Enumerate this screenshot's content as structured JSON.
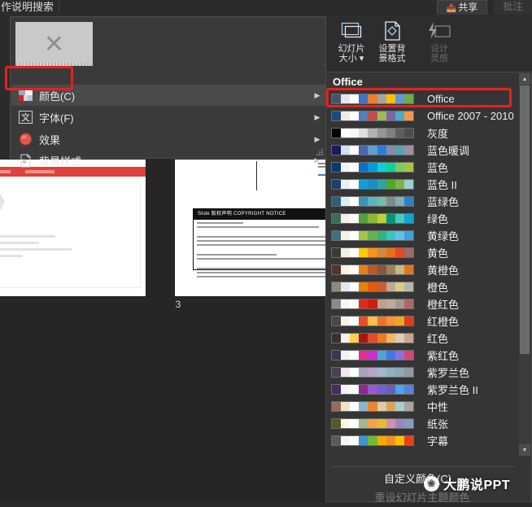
{
  "topbar": {
    "tell_me_text": "作说明搜索",
    "share_label": "共享",
    "share_icon": "share-icon",
    "far_button_label": "批注"
  },
  "ribbon": {
    "buttons": [
      {
        "id": "slide-size",
        "label": "幻灯片\n大小 ▾",
        "icon": "slide-size-icon",
        "disabled": false
      },
      {
        "id": "format-background",
        "label": "设置背\n景格式",
        "icon": "format-background-icon",
        "disabled": false
      },
      {
        "id": "design-ideas",
        "label": "设计\n灵感",
        "icon": "design-ideas-icon",
        "disabled": true
      }
    ]
  },
  "variants_menu": {
    "preview_icon": "x-placeholder-icon",
    "items": [
      {
        "id": "color",
        "label": "颜色(C)",
        "icon": "color-palette-icon",
        "selected": true,
        "has_submenu": true
      },
      {
        "id": "font",
        "label": "字体(F)",
        "icon": "font-icon",
        "selected": false,
        "has_submenu": true
      },
      {
        "id": "effect",
        "label": "效果",
        "icon": "effect-circle-icon",
        "selected": false,
        "has_submenu": true
      },
      {
        "id": "bgstyle",
        "label": "背景样式",
        "icon": "background-style-icon",
        "selected": false,
        "has_submenu": true
      }
    ],
    "arrow_glyph": "▶"
  },
  "annotations": {
    "highlight_color": "#e8201f",
    "boxes": [
      "color-menu-item",
      "office-theme-row"
    ]
  },
  "stage": {
    "slide_number": "3",
    "slide_left": {
      "title_bar_color": "#e0413a"
    },
    "slide_mid": {
      "notice_header": "Slide 版权声明 COPYRIGHT NOTICE"
    }
  },
  "flyout": {
    "title": "Office",
    "custom_colors_label": "自定义颜色(C)...",
    "reset_colors_label": "重设幻灯片主题颜色",
    "reset_disabled": true,
    "scroll_up_glyph": "▲",
    "scroll_down_glyph": "▼",
    "themes": [
      {
        "name": "Office",
        "selected": true,
        "colors": [
          "#44546a",
          "#e7e6e6",
          "#ffffff",
          "#4472c4",
          "#ed7d31",
          "#a5a5a5",
          "#ffc000",
          "#5b9bd5",
          "#70ad47"
        ]
      },
      {
        "name": "Office 2007 - 2010",
        "selected": false,
        "colors": [
          "#1f497d",
          "#eeece1",
          "#ffffff",
          "#4f81bd",
          "#c0504d",
          "#9bbb59",
          "#8064a2",
          "#4bacc6",
          "#f79646"
        ]
      },
      {
        "name": "灰度",
        "selected": false,
        "colors": [
          "#000000",
          "#ffffff",
          "#f8f8f8",
          "#dddddd",
          "#b2b2b2",
          "#969696",
          "#808080",
          "#5f5f5f",
          "#4d4d4d"
        ]
      },
      {
        "name": "蓝色暖调",
        "selected": false,
        "colors": [
          "#1a1a5e",
          "#cfe2f3",
          "#ffffff",
          "#4a66ac",
          "#629dd1",
          "#297fd5",
          "#7f8fa9",
          "#5aa2ae",
          "#9d90a0"
        ]
      },
      {
        "name": "蓝色",
        "selected": false,
        "colors": [
          "#073a6f",
          "#f2f2f2",
          "#ffffff",
          "#0f6fc6",
          "#009dd9",
          "#0bd0d9",
          "#10cf9b",
          "#7cca62",
          "#a5c249"
        ]
      },
      {
        "name": "蓝色 II",
        "selected": false,
        "colors": [
          "#1c3f6e",
          "#e9eef2",
          "#ffffff",
          "#0f9ed5",
          "#1790c3",
          "#2fa4a4",
          "#4ea72e",
          "#7fb24b",
          "#a0cfd0"
        ]
      },
      {
        "name": "蓝绿色",
        "selected": false,
        "colors": [
          "#335e78",
          "#ddeff5",
          "#ffffff",
          "#3494ba",
          "#58b6c0",
          "#75bda7",
          "#7a8c8e",
          "#84acb6",
          "#2683c6"
        ]
      },
      {
        "name": "绿色",
        "selected": false,
        "colors": [
          "#3c6b5b",
          "#f2f2e6",
          "#ffffff",
          "#549e39",
          "#8ab833",
          "#c0cf3a",
          "#029676",
          "#4ec6c0",
          "#13a4d4"
        ]
      },
      {
        "name": "黄绿色",
        "selected": false,
        "colors": [
          "#43707a",
          "#f4f4e6",
          "#ffffff",
          "#a2c441",
          "#62b44a",
          "#2fb67c",
          "#35c6c4",
          "#5cc2e8",
          "#3f9fe0"
        ]
      },
      {
        "name": "黄色",
        "selected": false,
        "colors": [
          "#3b3b33",
          "#f3f0e2",
          "#ffffff",
          "#ffca08",
          "#f8931d",
          "#ce8d3e",
          "#ec7016",
          "#e64823",
          "#9c6a6a"
        ]
      },
      {
        "name": "黄橙色",
        "selected": false,
        "colors": [
          "#51342a",
          "#fdf2e4",
          "#ffffff",
          "#e48312",
          "#bd582c",
          "#865640",
          "#9b8357",
          "#c2bc80",
          "#e0751c"
        ]
      },
      {
        "name": "橙色",
        "selected": false,
        "colors": [
          "#8c8c78",
          "#dfeaf1",
          "#ffffff",
          "#e48312",
          "#e8590c",
          "#cf5b34",
          "#c0a98d",
          "#d4cc8d",
          "#b6b6a6"
        ]
      },
      {
        "name": "橙红色",
        "selected": false,
        "colors": [
          "#8b8b8b",
          "#f6f6f6",
          "#ffffff",
          "#e02a1d",
          "#cf1c13",
          "#c0a08d",
          "#bfaaa0",
          "#a59891",
          "#ab6a6a"
        ]
      },
      {
        "name": "红橙色",
        "selected": false,
        "colors": [
          "#484848",
          "#f6f4e9",
          "#ffffff",
          "#e84c22",
          "#ffbd47",
          "#e8762d",
          "#ff8f34",
          "#e9a820",
          "#e03c12"
        ]
      },
      {
        "name": "红色",
        "selected": false,
        "colors": [
          "#3b2f2f",
          "#f7f0e5",
          "#ffd24d",
          "#a5160f",
          "#de4c2e",
          "#ef7820",
          "#f0b860",
          "#d8cdbb",
          "#c6a593"
        ]
      },
      {
        "name": "紫红色",
        "selected": false,
        "colors": [
          "#3f3550",
          "#f2f2f2",
          "#ffffff",
          "#e32d91",
          "#c830cc",
          "#4ea6dc",
          "#4775e7",
          "#8971e1",
          "#d54773"
        ]
      },
      {
        "name": "紫罗兰色",
        "selected": false,
        "colors": [
          "#4b3f52",
          "#efe7f2",
          "#ffffff",
          "#a9a0c0",
          "#b4a6c6",
          "#a3b7cc",
          "#91b0be",
          "#8fa8b5",
          "#9299a3"
        ]
      },
      {
        "name": "紫罗兰色 II",
        "selected": false,
        "colors": [
          "#4b2a5c",
          "#f7f2f8",
          "#ffffff",
          "#92278f",
          "#9b57d3",
          "#755dd9",
          "#665eb8",
          "#45a5ed",
          "#5982db"
        ]
      },
      {
        "name": "中性",
        "selected": false,
        "colors": [
          "#996b5e",
          "#efe3c6",
          "#ffffff",
          "#8cb4d0",
          "#e88536",
          "#e0cba7",
          "#d9a460",
          "#a9cfcb",
          "#a9a39b"
        ]
      },
      {
        "name": "纸张",
        "selected": false,
        "colors": [
          "#505c28",
          "#fdf7dd",
          "#ffffff",
          "#a5b592",
          "#f3a447",
          "#e7bc29",
          "#d092a7",
          "#9c85c0",
          "#809ec2"
        ]
      },
      {
        "name": "字幕",
        "selected": false,
        "colors": [
          "#5b5b5b",
          "#f6f6f6",
          "#ffffff",
          "#3f93d2",
          "#72ba36",
          "#f7ab00",
          "#f38e20",
          "#ffc000",
          "#e8401e"
        ]
      }
    ]
  },
  "watermark": {
    "logo_glyph": "❀",
    "text": "大鹏说PPT",
    "bottom_dots": "...."
  }
}
